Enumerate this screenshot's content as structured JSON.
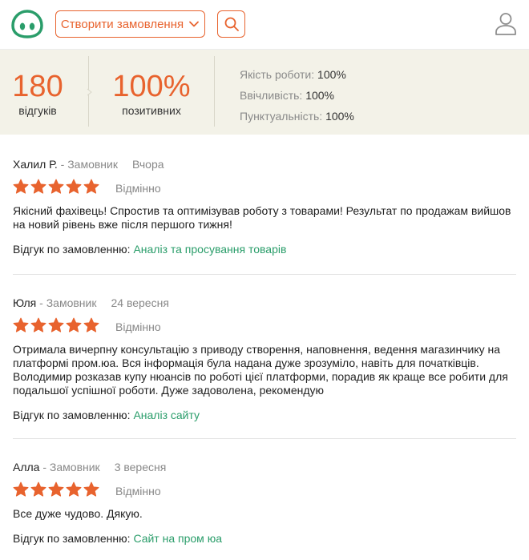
{
  "header": {
    "create_label": "Створити замовлення",
    "logo_icon": "logo-icon",
    "search_icon": "search-icon",
    "user_icon": "user-icon",
    "accent": "#e8632e"
  },
  "stats": {
    "reviews_count": "180",
    "reviews_label": "відгуків",
    "positive_percent": "100%",
    "positive_label": "позитивних",
    "ratings": [
      {
        "label": "Якість роботи:",
        "value": "100%"
      },
      {
        "label": "Ввічливість:",
        "value": "100%"
      },
      {
        "label": "Пунктуальність:",
        "value": "100%"
      }
    ]
  },
  "reviews": [
    {
      "name": "Халил Р.",
      "role": " - Замовник",
      "date": "Вчора",
      "stars": 5,
      "grade": "Відмінно",
      "text": "Якісний фахівець! Спростив та оптимізував роботу з товарами! Результат по продажам вийшов на новий рівень вже після першого тижня!",
      "order_prefix": "Відгук по замовленню: ",
      "order_link": "Аналіз та просування товарів"
    },
    {
      "name": "Юля",
      "role": " - Замовник",
      "date": "24 вересня",
      "stars": 5,
      "grade": "Відмінно",
      "text": "Отримала вичерпну консультацію з приводу створення, наповнення, ведення магазинчику на платформі пром.юа. Вся інформація була надана дуже зрозуміло, навіть для початківців. Володимир розказав купу нюансів по роботі цієї платформи, порадив як краще все робити для подальшої успішної роботи. Дуже задоволена, рекомендую",
      "order_prefix": "Відгук по замовленню: ",
      "order_link": "Аналіз сайту"
    },
    {
      "name": "Алла",
      "role": " - Замовник",
      "date": "3 вересня",
      "stars": 5,
      "grade": "Відмінно",
      "text": "Все дуже чудово. Дякую.",
      "order_prefix": "Відгук по замовленню: ",
      "order_link": "Сайт на пром юа"
    }
  ]
}
